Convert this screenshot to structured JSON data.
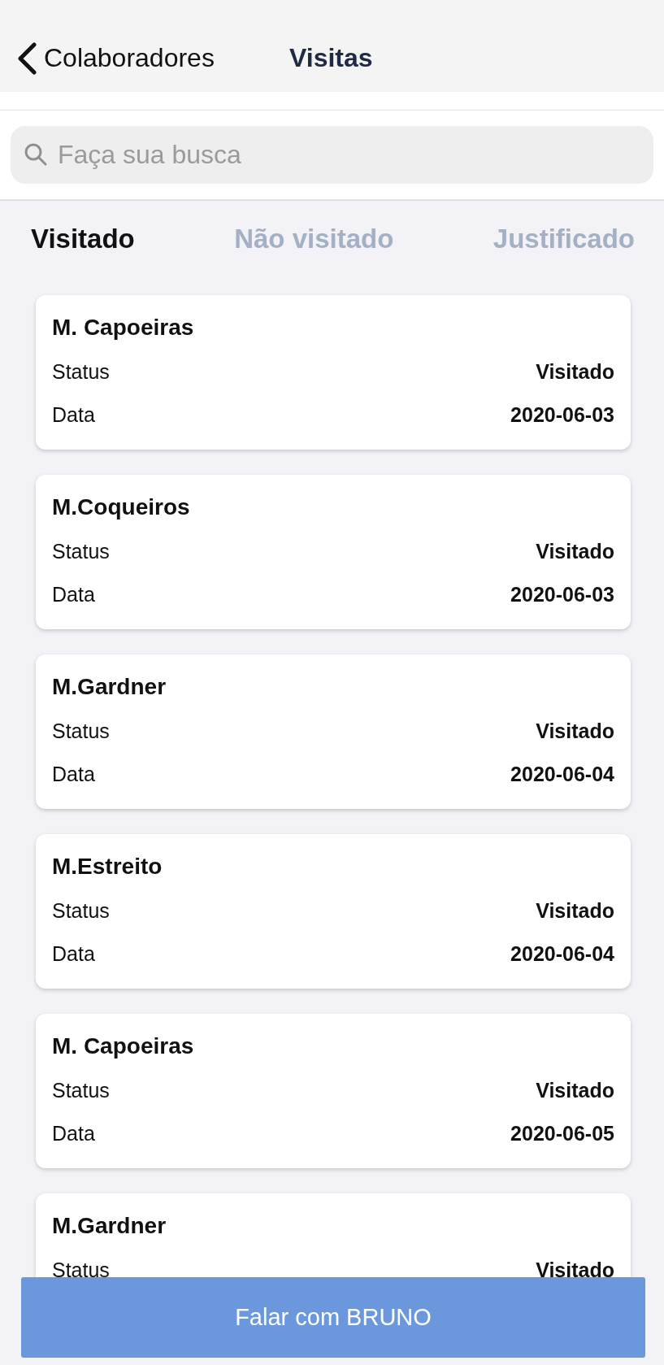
{
  "nav": {
    "back_label": "Colaboradores",
    "title": "Visitas"
  },
  "search": {
    "placeholder": "Faça sua busca"
  },
  "tabs": [
    {
      "label": "Visitado",
      "selected": true
    },
    {
      "label": "Não visitado",
      "selected": false
    },
    {
      "label": "Justificado",
      "selected": false
    }
  ],
  "visits": [
    {
      "name": "M. Capoeiras",
      "status_label": "Status",
      "status": "Visitado",
      "date_label": "Data",
      "date": "2020-06-03"
    },
    {
      "name": "M.Coqueiros",
      "status_label": "Status",
      "status": "Visitado",
      "date_label": "Data",
      "date": "2020-06-03"
    },
    {
      "name": "M.Gardner",
      "status_label": "Status",
      "status": "Visitado",
      "date_label": "Data",
      "date": "2020-06-04"
    },
    {
      "name": "M.Estreito",
      "status_label": "Status",
      "status": "Visitado",
      "date_label": "Data",
      "date": "2020-06-04"
    },
    {
      "name": "M. Capoeiras",
      "status_label": "Status",
      "status": "Visitado",
      "date_label": "Data",
      "date": "2020-06-05"
    },
    {
      "name": "M.Gardner",
      "status_label": "Status",
      "status": "Visitado"
    }
  ],
  "action_button": "Falar com BRUNO"
}
